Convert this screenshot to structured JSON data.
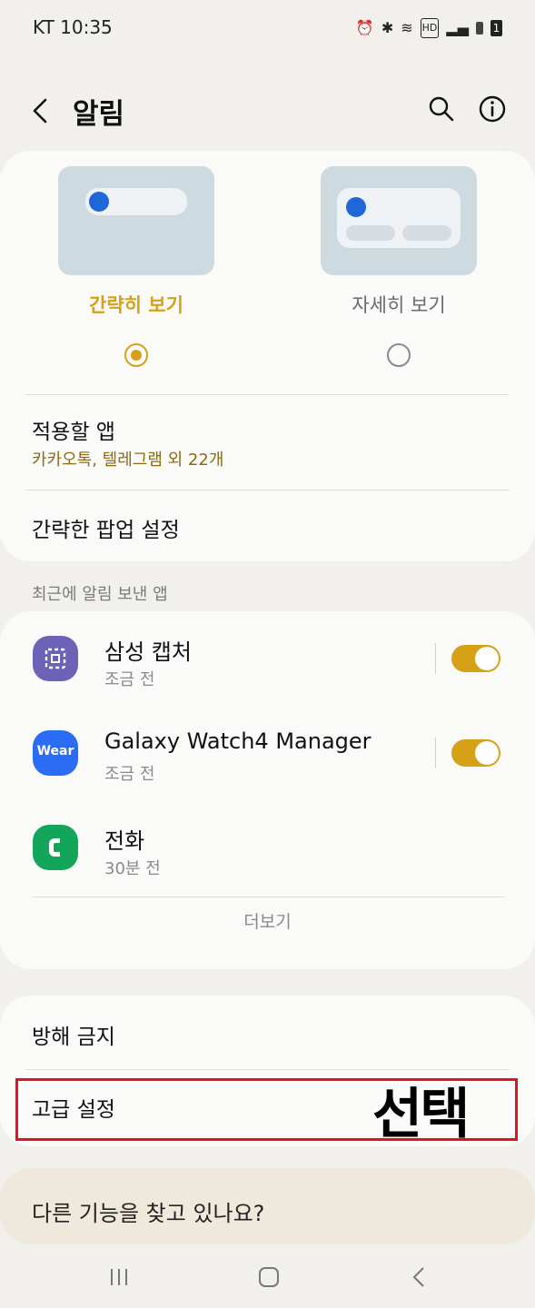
{
  "status_bar": {
    "carrier_time": "KT 10:35",
    "battery_level": "1"
  },
  "header": {
    "title": "알림"
  },
  "style_picker": {
    "options": [
      {
        "label": "간략히 보기",
        "selected": true
      },
      {
        "label": "자세히 보기",
        "selected": false
      }
    ]
  },
  "settings": {
    "apply_apps": {
      "title": "적용할 앱",
      "subtitle": "카카오톡, 텔레그램 외 22개"
    },
    "popup_settings": {
      "title": "간략한 팝업 설정"
    }
  },
  "recent": {
    "section_label": "최근에 알림 보낸 앱",
    "apps": [
      {
        "name": "삼성 캡처",
        "time": "조금 전",
        "toggle_on": true,
        "icon": "capture-icon"
      },
      {
        "name": "Galaxy Watch4 Manager",
        "time": "조금 전",
        "toggle_on": true,
        "icon": "wear-icon",
        "icon_text": "Wear"
      },
      {
        "name": "전화",
        "time": "30분 전",
        "icon": "phone-icon"
      }
    ],
    "more_label": "더보기"
  },
  "misc": {
    "dnd": "방해 금지",
    "advanced": "고급 설정",
    "annotation": "선택"
  },
  "footer": {
    "question": "다른 기능을 찾고 있나요?"
  },
  "colors": {
    "accent": "#d6a117",
    "highlight": "#e0141d",
    "bg": "#f2f0ec"
  }
}
